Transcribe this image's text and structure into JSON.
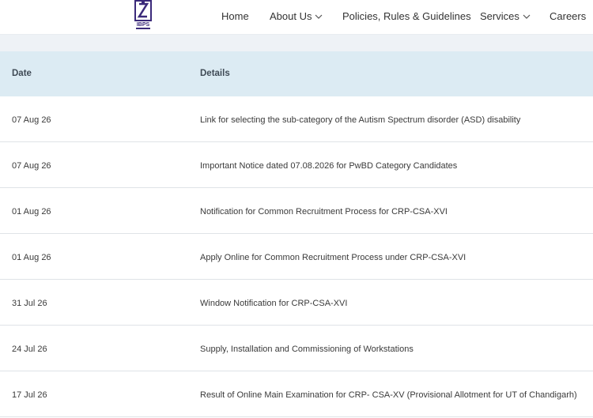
{
  "header": {
    "logo_text": "IBPS",
    "nav": [
      {
        "label": "Home",
        "dropdown": false
      },
      {
        "label": "About Us",
        "dropdown": true
      },
      {
        "label": "Policies, Rules & Guidelines",
        "dropdown": false
      },
      {
        "label": "Services",
        "dropdown": true
      },
      {
        "label": "Careers",
        "dropdown": false
      }
    ]
  },
  "table": {
    "columns": [
      "Date",
      "Details"
    ],
    "rows": [
      {
        "date": "07 Aug 26",
        "details": "Link for selecting the sub-category of the Autism Spectrum disorder (ASD) disability"
      },
      {
        "date": "07 Aug 26",
        "details": "Important Notice dated 07.08.2026 for PwBD Category Candidates"
      },
      {
        "date": "01 Aug 26",
        "details": "Notification for Common Recruitment Process for CRP-CSA-XVI"
      },
      {
        "date": "01 Aug 26",
        "details": "Apply Online for Common Recruitment Process under CRP-CSA-XVI"
      },
      {
        "date": "31 Jul 26",
        "details": "Window Notification for CRP-CSA-XVI"
      },
      {
        "date": "24 Jul 26",
        "details": "Supply, Installation and Commissioning of Workstations"
      },
      {
        "date": "17 Jul 26",
        "details": "Result of Online Main Examination for CRP- CSA-XV (Provisional Allotment for UT of Chandigarh)"
      }
    ]
  },
  "colors": {
    "header_bg": "#ffffff",
    "band_bg": "#eef2f6",
    "table_head_bg": "#dcebf3",
    "logo_color": "#3b2a7a",
    "row_border": "#dfe3e7"
  }
}
